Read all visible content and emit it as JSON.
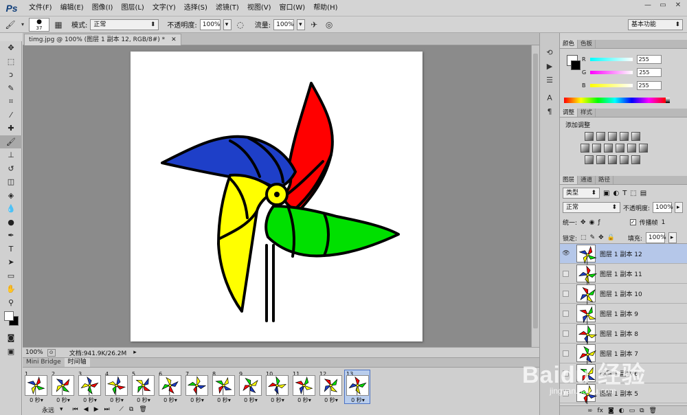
{
  "app": {
    "logo": "Ps"
  },
  "menu": [
    "文件(F)",
    "编辑(E)",
    "图像(I)",
    "图层(L)",
    "文字(Y)",
    "选择(S)",
    "滤镜(T)",
    "视图(V)",
    "窗口(W)",
    "帮助(H)"
  ],
  "window_controls": {
    "minimize": "—",
    "restore": "▭",
    "close": "✕"
  },
  "options": {
    "brush_size": "37",
    "mode_label": "模式:",
    "mode_value": "正常",
    "opacity_label": "不透明度:",
    "opacity_value": "100%",
    "flow_label": "流量:",
    "flow_value": "100%"
  },
  "workspace": "基本功能",
  "document": {
    "tab_title": "timg.jpg @ 100% (图层 1 副本 12, RGB/8#) *",
    "zoom": "100%",
    "doc_info": "文档:941.9K/26.2M"
  },
  "timeline": {
    "tabs": [
      "Mini Bridge",
      "时间轴"
    ],
    "active_tab": 1,
    "frames": [
      {
        "num": "1",
        "time": "0 秒"
      },
      {
        "num": "2",
        "time": "0 秒"
      },
      {
        "num": "3",
        "time": "0 秒"
      },
      {
        "num": "4",
        "time": "0 秒"
      },
      {
        "num": "5",
        "time": "0 秒"
      },
      {
        "num": "6",
        "time": "0 秒"
      },
      {
        "num": "7",
        "time": "0 秒"
      },
      {
        "num": "8",
        "time": "0 秒"
      },
      {
        "num": "9",
        "time": "0 秒"
      },
      {
        "num": "10",
        "time": "0 秒"
      },
      {
        "num": "11",
        "time": "0 秒"
      },
      {
        "num": "12",
        "time": "0 秒"
      },
      {
        "num": "13",
        "time": "0 秒"
      }
    ],
    "selected_frame": 12,
    "loop": "永远"
  },
  "color_panel": {
    "tabs": [
      "颜色",
      "色板"
    ],
    "r_label": "R",
    "g_label": "G",
    "b_label": "B",
    "r": "255",
    "g": "255",
    "b": "255"
  },
  "adjust_panel": {
    "tabs": [
      "调整",
      "样式"
    ],
    "title": "添加调整"
  },
  "layers_panel": {
    "tabs": [
      "图层",
      "通道",
      "路径"
    ],
    "kind_label": "类型",
    "blend_mode": "正常",
    "opacity_label": "不透明度:",
    "opacity": "100%",
    "unify_label": "统一:",
    "propagate_label": "传播帧",
    "propagate_value": "1",
    "lock_label": "锁定:",
    "fill_label": "填充:",
    "fill": "100%",
    "layers": [
      {
        "name": "图层 1 副本 12",
        "visible": true
      },
      {
        "name": "图层 1 副本 11",
        "visible": false
      },
      {
        "name": "图层 1 副本 10",
        "visible": false
      },
      {
        "name": "图层 1 副本 9",
        "visible": false
      },
      {
        "name": "图层 1 副本 8",
        "visible": false
      },
      {
        "name": "图层 1 副本 7",
        "visible": false
      },
      {
        "name": "图层 1 副本 6",
        "visible": false
      },
      {
        "name": "图层 1 副本 5",
        "visible": false
      }
    ]
  },
  "colors": {
    "red": "#ff0000",
    "blue": "#1e3fc8",
    "yellow": "#ffff00",
    "green": "#00e000"
  },
  "watermark": {
    "main": "Baidu 经验",
    "sub": "jingyan.baidu.com"
  }
}
